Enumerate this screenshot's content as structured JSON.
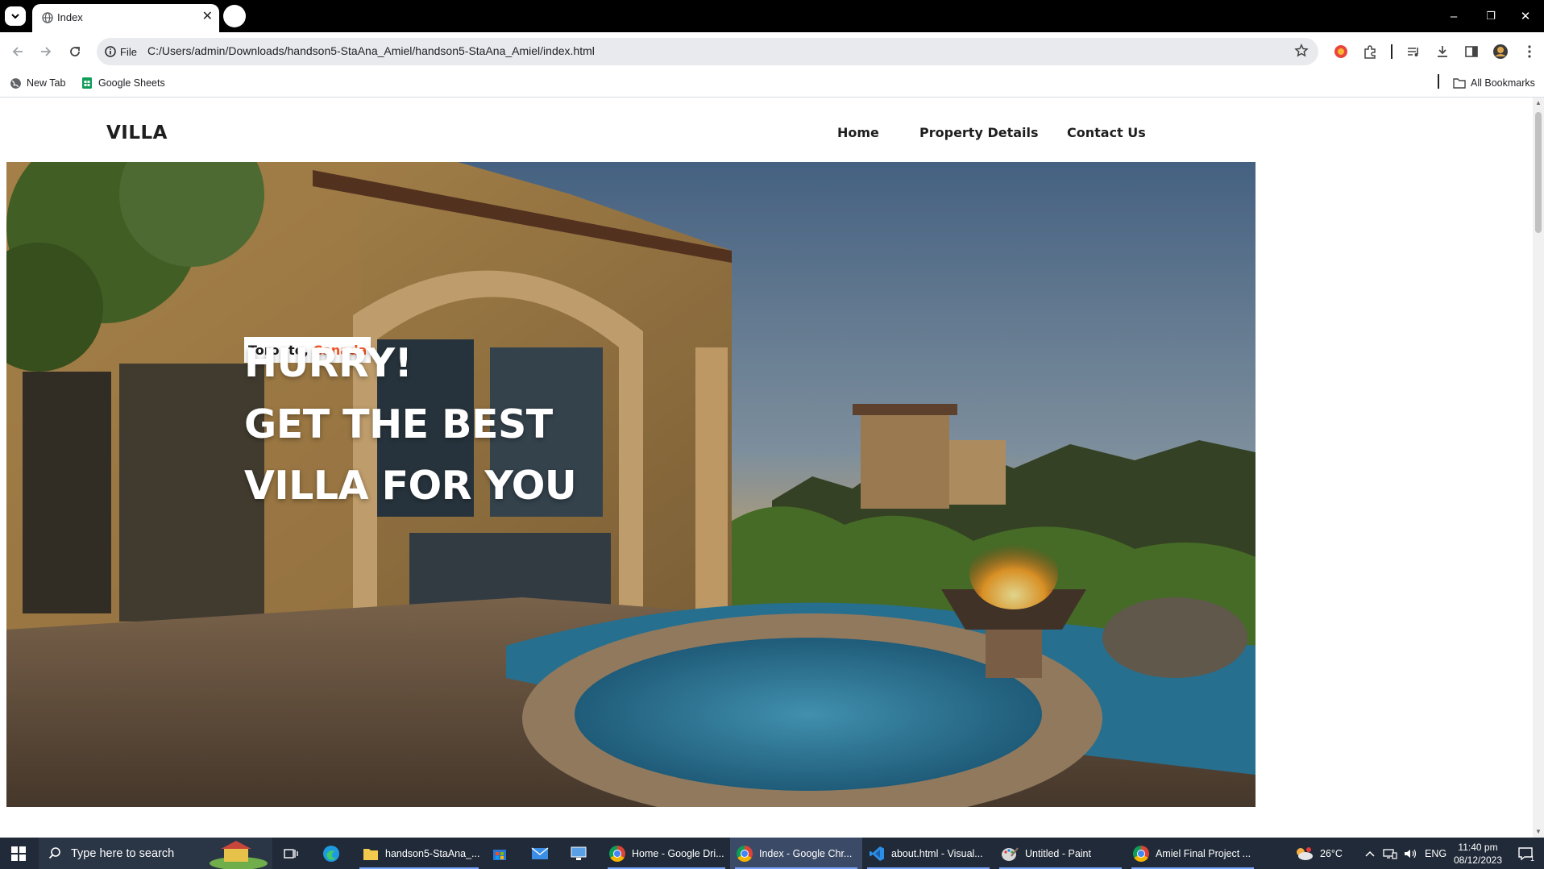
{
  "browser": {
    "tab": {
      "title": "Index",
      "close": "✕"
    },
    "window_controls": {
      "minimize": "–",
      "restore": "❐",
      "close": "✕"
    },
    "address": {
      "scheme_label": "File",
      "url": "C:/Users/admin/Downloads/handson5-StaAna_Amiel/handson5-StaAna_Amiel/index.html"
    },
    "bookmarks": [
      {
        "label": "New Tab"
      },
      {
        "label": "Google Sheets"
      }
    ],
    "all_bookmarks": "All Bookmarks"
  },
  "site": {
    "logo": "VILLA",
    "nav": [
      "Home",
      "Property Details",
      "Contact Us"
    ],
    "hero": {
      "location_city": "Toronto,",
      "location_country": "Canada",
      "headline": [
        "HURRY!",
        "GET THE BEST",
        "VILLA FOR YOU"
      ]
    },
    "colors": {
      "accent": "#f35525",
      "text": "#1e1e1e"
    }
  },
  "taskbar": {
    "search_placeholder": "Type here to search",
    "apps": [
      {
        "label": "handson5-StaAna_...",
        "icon": "folder-icon"
      },
      {
        "label": "Home - Google Dri...",
        "icon": "chrome-icon"
      },
      {
        "label": "Index - Google Chr...",
        "icon": "chrome-icon",
        "active": true
      },
      {
        "label": "about.html - Visual...",
        "icon": "vscode-icon"
      },
      {
        "label": "Untitled - Paint",
        "icon": "paint-icon"
      },
      {
        "label": "Amiel Final Project ...",
        "icon": "chrome-icon"
      }
    ],
    "weather": "26°C",
    "language": "ENG",
    "time": "11:40 pm",
    "date": "08/12/2023",
    "notification_count": "1"
  }
}
